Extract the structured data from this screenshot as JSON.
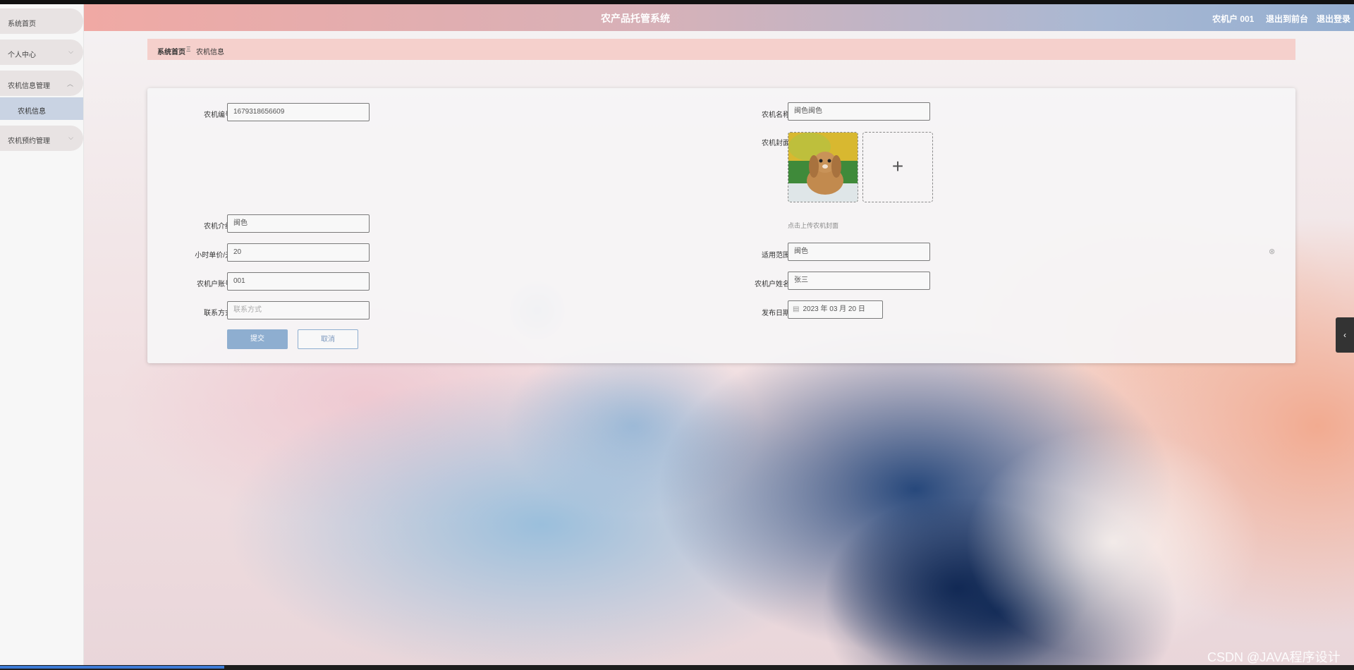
{
  "app": {
    "title": "农产品托管系统"
  },
  "topbar": {
    "user": "农机户 001",
    "exit_backend": "退出到前台",
    "logout": "退出登录"
  },
  "sidebar": {
    "items": [
      {
        "label": "系统首页"
      },
      {
        "label": "个人中心"
      },
      {
        "label": "农机信息管理"
      },
      {
        "label": "农机预约管理"
      }
    ],
    "submenu": {
      "label": "农机信息"
    }
  },
  "breadcrumb": {
    "home": "系统首页",
    "sep": "Ξ",
    "current": "农机信息"
  },
  "form": {
    "machine_no": {
      "label": "农机编号",
      "value": "1679318656609"
    },
    "machine_name": {
      "label": "农机名称",
      "value": "闽色闽色"
    },
    "cover": {
      "label": "农机封面",
      "hint": "点击上传农机封面"
    },
    "intro": {
      "label": "农机介绍",
      "value": "闽色"
    },
    "price": {
      "label": "小时单价/元",
      "value": "20"
    },
    "scope": {
      "label": "适用范围",
      "value": "闽色"
    },
    "owner_account": {
      "label": "农机户账号",
      "value": "001"
    },
    "owner_name": {
      "label": "农机户姓名",
      "value": "张三"
    },
    "contact": {
      "label": "联系方式",
      "placeholder": "联系方式"
    },
    "publish_date": {
      "label": "发布日期",
      "value": "2023 年 03 月 20 日"
    },
    "submit": "提交",
    "cancel": "取消"
  },
  "watermark": "CSDN @JAVA程序设计"
}
